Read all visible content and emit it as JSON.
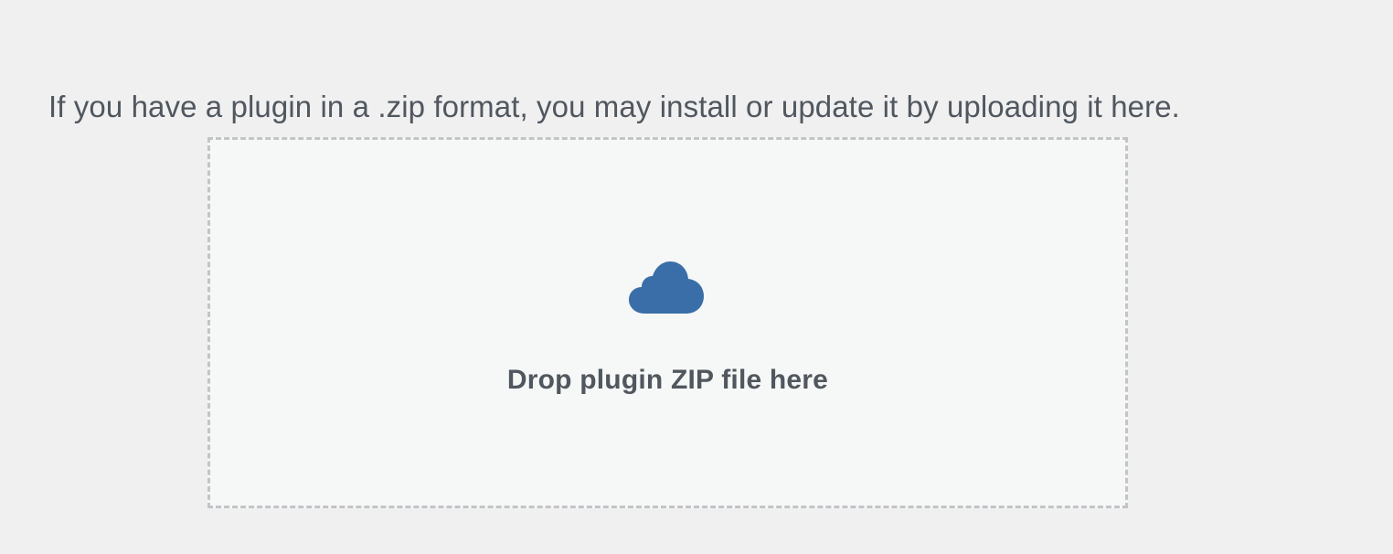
{
  "intro": {
    "text": "If you have a plugin in a .zip format, you may install or update it by uploading it here."
  },
  "dropzone": {
    "icon": "cloud-upload-icon",
    "label": "Drop plugin ZIP file here"
  },
  "colors": {
    "background": "#f0f0f1",
    "dropzone_background": "#f6f7f7",
    "dropzone_border": "#c3c4c7",
    "text": "#50575e",
    "accent": "#3a6ea8"
  }
}
